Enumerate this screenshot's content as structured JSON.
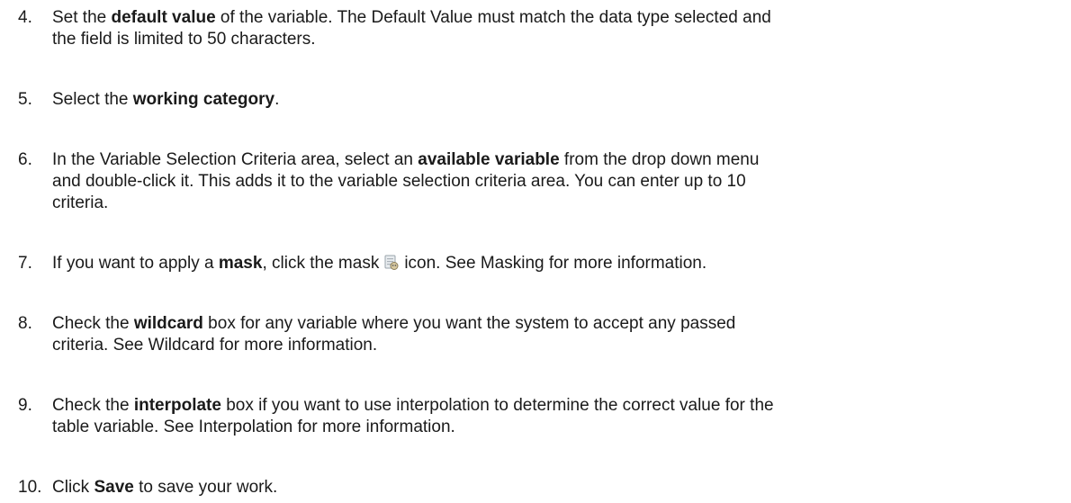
{
  "steps": [
    {
      "number": "4.",
      "line1_pre": "Set the ",
      "line1_bold": "default value",
      "line1_post": " of the variable. The Default Value must match the data type selected and",
      "line2": "the field is limited to 50 characters."
    },
    {
      "number": "5.",
      "pre": "Select the ",
      "bold": "working category",
      "post": "."
    },
    {
      "number": "6.",
      "line1_pre": "In the Variable Selection Criteria area, select an ",
      "line1_bold": "available variable",
      "line1_post": " from the drop down menu",
      "line2": "and double-click it. This adds it to the variable selection criteria area. You can enter up to 10",
      "line3": "criteria."
    },
    {
      "number": "7.",
      "pre": "If you want to apply a ",
      "bold": "mask",
      "mid": ", click the mask",
      "post": "icon. See Masking for more information.",
      "icon": "mask-icon"
    },
    {
      "number": "8.",
      "line1_pre": "Check the ",
      "line1_bold": "wildcard",
      "line1_post": " box for any variable where you want the system to accept any passed",
      "line2": "criteria. See Wildcard for more information."
    },
    {
      "number": "9.",
      "line1_pre": "Check the ",
      "line1_bold": "interpolate",
      "line1_post": " box if you want to use interpolation to determine the correct value for the",
      "line2": "table variable. See Interpolation for more information."
    },
    {
      "number": "10.",
      "pre": "Click ",
      "bold": "Save",
      "post": " to save your work."
    }
  ]
}
